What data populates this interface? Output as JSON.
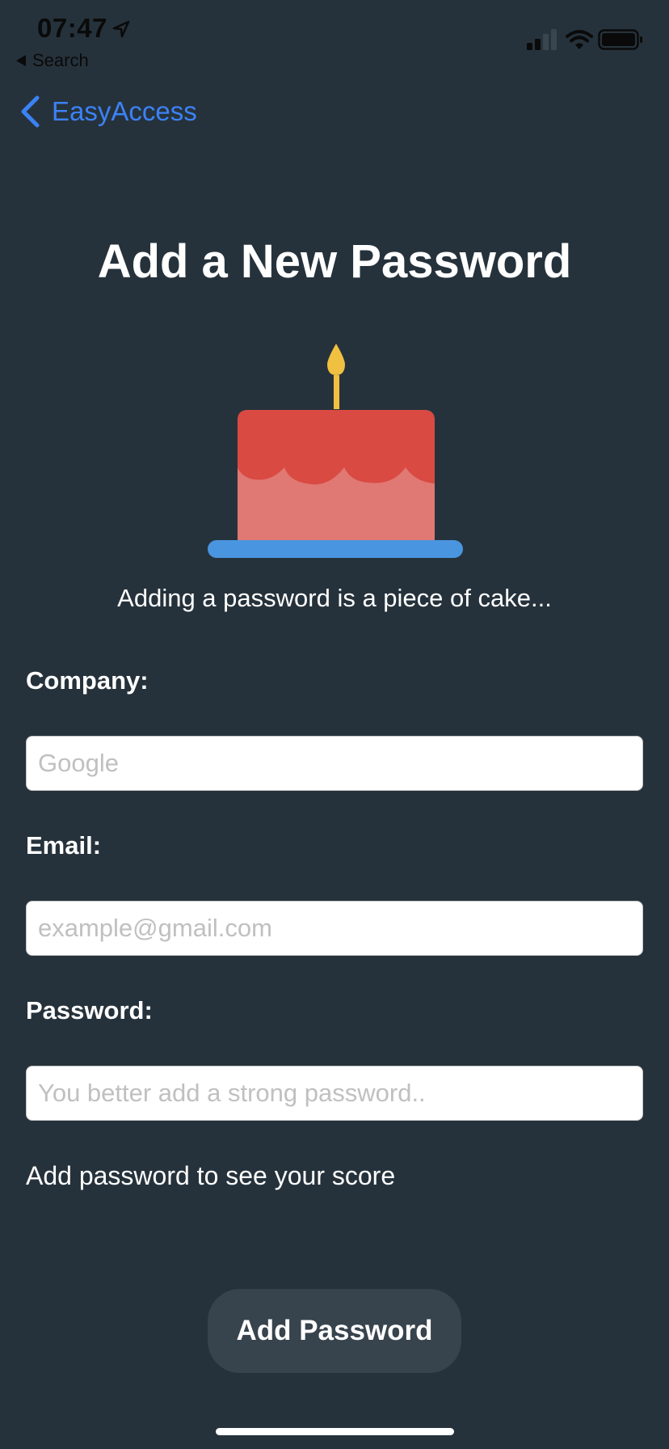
{
  "status_bar": {
    "time": "07:47",
    "back_app_label": "Search"
  },
  "nav": {
    "back_label": "EasyAccess",
    "accent_color": "#3b82f6"
  },
  "page": {
    "title": "Add a New Password",
    "tagline": "Adding a password is a piece of cake..."
  },
  "form": {
    "company": {
      "label": "Company:",
      "placeholder": "Google",
      "value": ""
    },
    "email": {
      "label": "Email:",
      "placeholder": "example@gmail.com",
      "value": ""
    },
    "password": {
      "label": "Password:",
      "placeholder": "You better add a strong password..",
      "value": ""
    },
    "score_text": "Add password to see your score",
    "submit_label": "Add Password"
  },
  "icons": {
    "illustration": "cake-icon",
    "back": "chevron-left-icon",
    "location": "location-arrow-icon",
    "signal": "cellular-signal-icon",
    "wifi": "wifi-icon",
    "battery": "battery-icon"
  },
  "colors": {
    "background": "#26323b",
    "button": "#37434d",
    "cake_top": "#d94a42",
    "cake_bottom": "#e07873",
    "plate": "#4a95e0",
    "candle": "#f0c040"
  }
}
